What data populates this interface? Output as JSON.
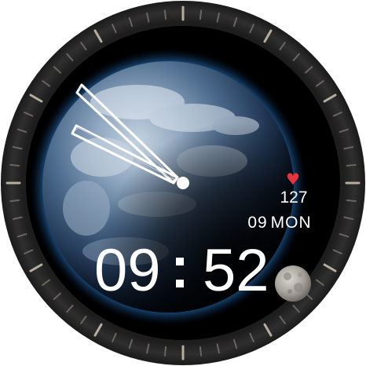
{
  "watch_face": {
    "heart_rate": {
      "icon": "heart-icon",
      "value": "127",
      "color": "#e8343a"
    },
    "date": {
      "day": "09",
      "weekday": "MON"
    },
    "time": {
      "hours": "09",
      "minutes": "52"
    },
    "moon_icon": "moon-icon",
    "colors": {
      "bezel": "#2b2b2b",
      "tick": "#8c8478",
      "text": "#ffffff",
      "background": "#000000"
    }
  }
}
